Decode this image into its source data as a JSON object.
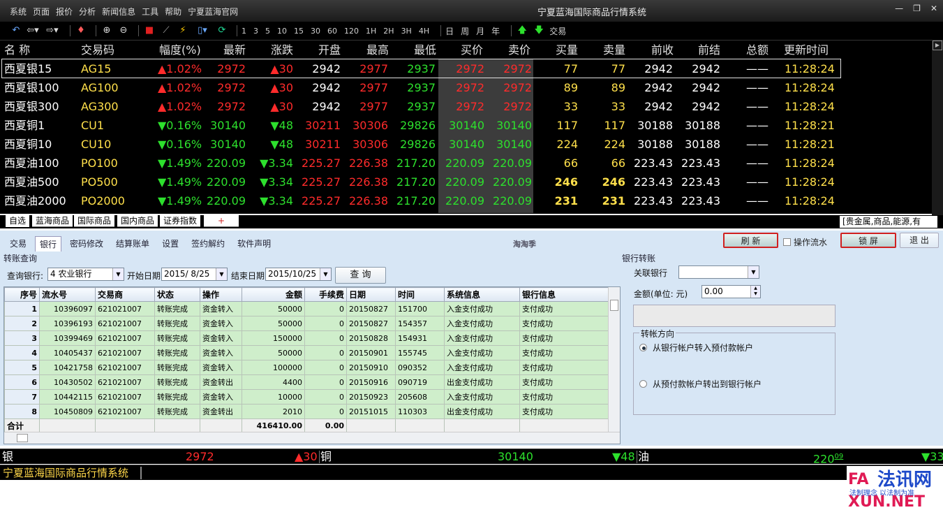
{
  "window": {
    "title": "宁夏蓝海国际商品行情系统",
    "menu": [
      "系统",
      "页面",
      "报价",
      "分析",
      "新闻信息",
      "工具",
      "帮助",
      "宁夏蓝海官网"
    ],
    "controls": [
      "—",
      "❐",
      "✕"
    ]
  },
  "toolbar": {
    "periods": [
      "1",
      "3",
      "5",
      "10",
      "15",
      "30",
      "60",
      "120",
      "1H",
      "2H",
      "3H",
      "4H"
    ],
    "cycles": [
      "日",
      "周",
      "月",
      "年"
    ],
    "trade_label": "交易"
  },
  "quote_table": {
    "headers": [
      "名  称",
      "交易码",
      "幅度(%)",
      "最新",
      "涨跌",
      "开盘",
      "最高",
      "最低",
      "买价",
      "卖价",
      "买量",
      "卖量",
      "前收",
      "前结",
      "总额",
      "更新时间"
    ],
    "rows": [
      {
        "name": "西夏银15",
        "code": "AG15",
        "dir": "up",
        "pct": "▲1.02%",
        "last": "2972",
        "chg": "▲30",
        "open": "2942",
        "high": "2977",
        "low": "2937",
        "bid": "2972",
        "ask": "2972",
        "bidv": "77",
        "askv": "77",
        "prev": "2942",
        "settle": "2942",
        "total": "——",
        "time": "11:28:24"
      },
      {
        "name": "西夏银100",
        "code": "AG100",
        "dir": "up",
        "pct": "▲1.02%",
        "last": "2972",
        "chg": "▲30",
        "open": "2942",
        "high": "2977",
        "low": "2937",
        "bid": "2972",
        "ask": "2972",
        "bidv": "89",
        "askv": "89",
        "prev": "2942",
        "settle": "2942",
        "total": "——",
        "time": "11:28:24"
      },
      {
        "name": "西夏银300",
        "code": "AG300",
        "dir": "up",
        "pct": "▲1.02%",
        "last": "2972",
        "chg": "▲30",
        "open": "2942",
        "high": "2977",
        "low": "2937",
        "bid": "2972",
        "ask": "2972",
        "bidv": "33",
        "askv": "33",
        "prev": "2942",
        "settle": "2942",
        "total": "——",
        "time": "11:28:24"
      },
      {
        "name": "西夏铜1",
        "code": "CU1",
        "dir": "down",
        "pct": "▼0.16%",
        "last": "30140",
        "chg": "▼48",
        "open": "30211",
        "high": "30306",
        "low": "29826",
        "bid": "30140",
        "ask": "30140",
        "bidv": "117",
        "askv": "117",
        "prev": "30188",
        "settle": "30188",
        "total": "——",
        "time": "11:28:21"
      },
      {
        "name": "西夏铜10",
        "code": "CU10",
        "dir": "down",
        "pct": "▼0.16%",
        "last": "30140",
        "chg": "▼48",
        "open": "30211",
        "high": "30306",
        "low": "29826",
        "bid": "30140",
        "ask": "30140",
        "bidv": "224",
        "askv": "224",
        "prev": "30188",
        "settle": "30188",
        "total": "——",
        "time": "11:28:21"
      },
      {
        "name": "西夏油100",
        "code": "PO100",
        "dir": "down",
        "pct": "▼1.49%",
        "last": "220.09",
        "chg": "▼3.34",
        "open": "225.27",
        "high": "226.38",
        "low": "217.20",
        "bid": "220.09",
        "ask": "220.09",
        "bidv": "66",
        "askv": "66",
        "prev": "223.43",
        "settle": "223.43",
        "total": "——",
        "time": "11:28:24"
      },
      {
        "name": "西夏油500",
        "code": "PO500",
        "dir": "down",
        "pct": "▼1.49%",
        "last": "220.09",
        "chg": "▼3.34",
        "open": "225.27",
        "high": "226.38",
        "low": "217.20",
        "bid": "220.09",
        "ask": "220.09",
        "bidv": "246",
        "askv": "246",
        "prev": "223.43",
        "settle": "223.43",
        "total": "——",
        "time": "11:28:24"
      },
      {
        "name": "西夏油2000",
        "code": "PO2000",
        "dir": "down",
        "pct": "▼1.49%",
        "last": "220.09",
        "chg": "▼3.34",
        "open": "225.27",
        "high": "226.38",
        "low": "217.20",
        "bid": "220.09",
        "ask": "220.09",
        "bidv": "231",
        "askv": "231",
        "prev": "223.43",
        "settle": "223.43",
        "total": "——",
        "time": "11:28:24"
      }
    ]
  },
  "sheet_tabs": [
    "自选",
    "蓝海商品",
    "国际商品",
    "国内商品",
    "证券指数",
    "+"
  ],
  "sheet_info": "[贵金属,商品,能源,有",
  "panel": {
    "tabs": [
      "交易",
      "银行",
      "密码修改",
      "结算账单",
      "设置",
      "签约解约",
      "软件声明"
    ],
    "center_label": "淘淘季",
    "refresh": "刷 新",
    "flow_check": "操作流水",
    "lock": "锁 屏",
    "exit": "退 出",
    "left_title": "转账查询",
    "query_bank_label": "查询银行:",
    "query_bank_value": "4 农业银行",
    "start_label": "开始日期",
    "start_value": "2015/ 8/25",
    "end_label": "结束日期",
    "end_value": "2015/10/25",
    "query_button": "查  询",
    "right_title": "银行转账",
    "link_bank_label": "关联银行",
    "amount_label": "金额(单位: 元)",
    "amount_value": "0.00",
    "direction_title": "转帐方向",
    "direction_in": "从银行帐户转入预付款帐户",
    "direction_out": "从预付款帐户转出到银行帐户"
  },
  "transfers": {
    "headers": [
      "序号",
      "流水号",
      "交易商",
      "状态",
      "操作",
      "金额",
      "手续费",
      "日期",
      "时间",
      "系统信息",
      "银行信息"
    ],
    "rows": [
      [
        "1",
        "10396097",
        "621021007",
        "转账完成",
        "资金转入",
        "50000",
        "0",
        "20150827",
        "151700",
        "入金支付成功",
        "支付成功"
      ],
      [
        "2",
        "10396193",
        "621021007",
        "转账完成",
        "资金转入",
        "50000",
        "0",
        "20150827",
        "154357",
        "入金支付成功",
        "支付成功"
      ],
      [
        "3",
        "10399469",
        "621021007",
        "转账完成",
        "资金转入",
        "150000",
        "0",
        "20150828",
        "154931",
        "入金支付成功",
        "支付成功"
      ],
      [
        "4",
        "10405437",
        "621021007",
        "转账完成",
        "资金转入",
        "50000",
        "0",
        "20150901",
        "155745",
        "入金支付成功",
        "支付成功"
      ],
      [
        "5",
        "10421758",
        "621021007",
        "转账完成",
        "资金转入",
        "100000",
        "0",
        "20150910",
        "090352",
        "入金支付成功",
        "支付成功"
      ],
      [
        "6",
        "10430502",
        "621021007",
        "转账完成",
        "资金转出",
        "4400",
        "0",
        "20150916",
        "090719",
        "出金支付成功",
        "支付成功"
      ],
      [
        "7",
        "10442115",
        "621021007",
        "转账完成",
        "资金转入",
        "10000",
        "0",
        "20150923",
        "205608",
        "入金支付成功",
        "支付成功"
      ],
      [
        "8",
        "10450809",
        "621021007",
        "转账完成",
        "资金转出",
        "2010",
        "0",
        "20151015",
        "110303",
        "出金支付成功",
        "支付成功"
      ]
    ],
    "total_label": "合计",
    "total_amount": "416410.00",
    "total_fee": "0.00"
  },
  "ticker": [
    {
      "name": "银",
      "price": "2972",
      "chg": "▲30",
      "dir": "up"
    },
    {
      "name": "铜",
      "price": "30140",
      "chg": "▼48",
      "dir": "down"
    },
    {
      "name": "油",
      "price": "220",
      "price_sup": "09",
      "chg": "▼33",
      "dir": "down"
    }
  ],
  "status_text": "宁夏蓝海国际商品行情系统",
  "watermark": {
    "text_cn": "法讯网",
    "text_en": "FAXUN.NET",
    "slogan": "以法制为准"
  },
  "colors": {
    "up": "#ff2b2b",
    "down": "#2de02d",
    "volume": "#ffe04b",
    "panel_bg": "#d7e6f5",
    "grid_row": "#cfeecb"
  }
}
